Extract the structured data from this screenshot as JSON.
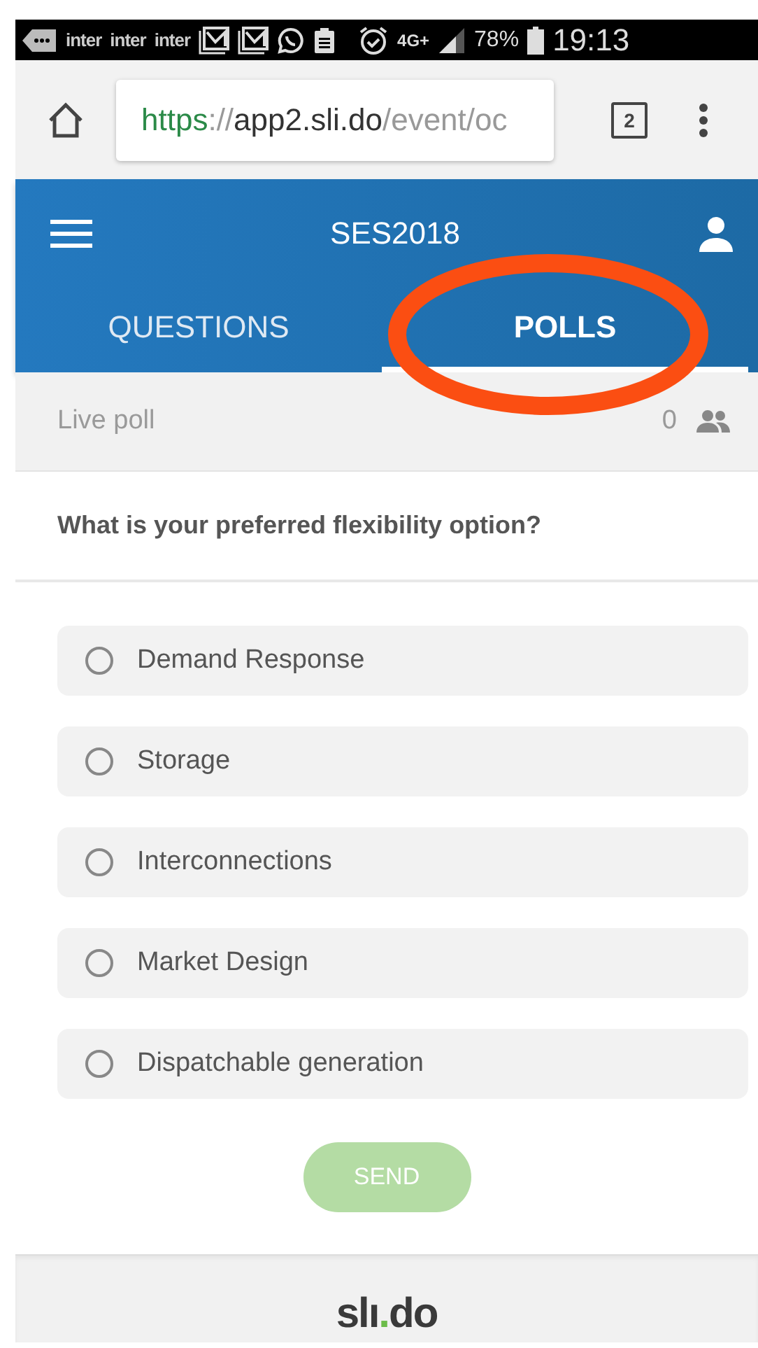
{
  "status_bar": {
    "carriers": [
      "inter",
      "inter",
      "inter"
    ],
    "network": "4G+",
    "battery": "78%",
    "time": "19:13"
  },
  "browser": {
    "url": {
      "scheme": "https",
      "separator": "://",
      "host": "app2.sli.do",
      "path": "/event/oc"
    },
    "tab_count": "2"
  },
  "header": {
    "title": "SES2018"
  },
  "tabs": [
    {
      "label": "QUESTIONS",
      "selected": false,
      "circled": false
    },
    {
      "label": "POLLS",
      "selected": true,
      "circled": true
    }
  ],
  "poll": {
    "label": "Live poll",
    "participants": "0",
    "question": "What is your preferred flexibility option?"
  },
  "options": [
    {
      "label": "Demand Response",
      "selected": false
    },
    {
      "label": "Storage",
      "selected": false
    },
    {
      "label": "Interconnections",
      "selected": false
    },
    {
      "label": "Market Design",
      "selected": false
    },
    {
      "label": "Dispatchable generation",
      "selected": false
    }
  ],
  "send": {
    "label": "SEND",
    "disabled": true
  },
  "footer": {
    "logo": [
      "slı",
      ".",
      "do"
    ]
  }
}
